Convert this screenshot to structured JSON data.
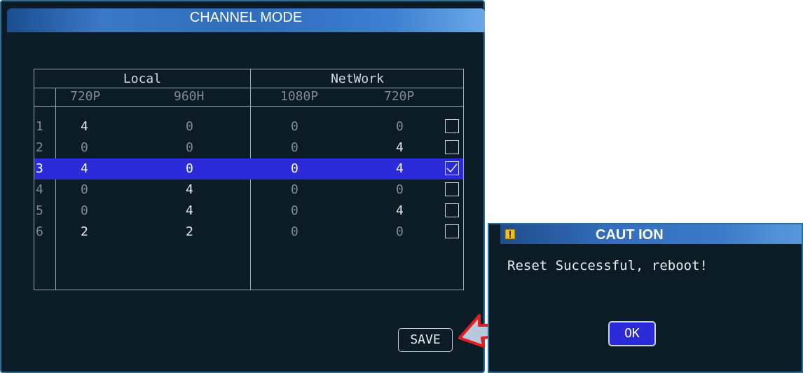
{
  "window": {
    "title": "CHANNEL MODE"
  },
  "table": {
    "group_headers": [
      "Local",
      "NetWork"
    ],
    "sub_headers": [
      "720P",
      "960H",
      "1080P",
      "720P"
    ],
    "rows": [
      {
        "index": "1",
        "values": [
          "4",
          "0",
          "0",
          "0"
        ],
        "checked": false
      },
      {
        "index": "2",
        "values": [
          "0",
          "0",
          "0",
          "4"
        ],
        "checked": false
      },
      {
        "index": "3",
        "values": [
          "4",
          "0",
          "0",
          "4"
        ],
        "checked": true
      },
      {
        "index": "4",
        "values": [
          "0",
          "4",
          "0",
          "0"
        ],
        "checked": false
      },
      {
        "index": "5",
        "values": [
          "0",
          "4",
          "0",
          "4"
        ],
        "checked": false
      },
      {
        "index": "6",
        "values": [
          "2",
          "2",
          "0",
          "0"
        ],
        "checked": false
      }
    ],
    "selected_row": 3
  },
  "save_button": {
    "label": "SAVE"
  },
  "dialog": {
    "title": "CAUT ION",
    "message": "Reset Successful, reboot!",
    "ok_label": "OK",
    "icon": "warning-icon"
  },
  "colors": {
    "background": "#0b1c27",
    "selection": "#2b2bd9",
    "titlebar": "#3b78c8",
    "arrow": "#e02020"
  }
}
